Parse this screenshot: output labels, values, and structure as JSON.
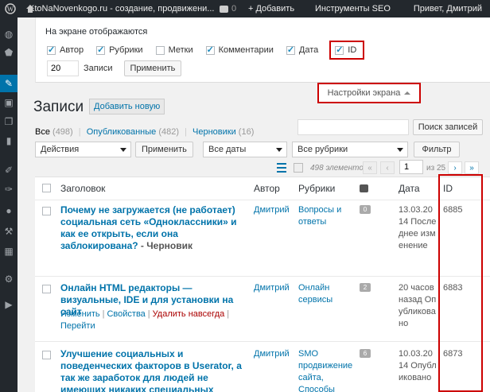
{
  "adminbar": {
    "site_name": "KtoNaNovenkogo.ru - создание, продвижени...",
    "comments_count": "0",
    "new_label": "Добавить",
    "seo_label": "Инструменты SEO",
    "greeting": "Привет, Дмитрий"
  },
  "screen_options": {
    "title": "На экране отображаются",
    "columns": [
      {
        "label": "Автор",
        "checked": true
      },
      {
        "label": "Рубрики",
        "checked": true
      },
      {
        "label": "Метки",
        "checked": false
      },
      {
        "label": "Комментарии",
        "checked": true
      },
      {
        "label": "Дата",
        "checked": true
      },
      {
        "label": "ID",
        "checked": true
      }
    ],
    "per_page_value": "20",
    "per_page_label": "Записи",
    "apply_label": "Применить",
    "toggle_label": "Настройки экрана"
  },
  "page": {
    "title": "Записи",
    "add_new": "Добавить новую"
  },
  "views": {
    "all_label": "Все",
    "all_count": "(498)",
    "published_label": "Опубликованные",
    "published_count": "(482)",
    "drafts_label": "Черновики",
    "drafts_count": "(16)"
  },
  "search": {
    "value": "",
    "button": "Поиск записей"
  },
  "tablenav": {
    "bulk_action": "Действия",
    "apply": "Применить",
    "dates": "Все даты",
    "categories": "Все рубрики",
    "filter": "Фильтр",
    "items": "498 элементов",
    "current_page": "1",
    "of_pages": "из 25",
    "first": "«",
    "prev": "‹",
    "next": "›",
    "last": "»"
  },
  "table": {
    "headers": {
      "title": "Заголовок",
      "author": "Автор",
      "categories": "Рубрики",
      "date": "Дата",
      "id": "ID"
    },
    "rows": [
      {
        "title": "Почему не загружается (не работает) социальная сеть «Одноклассники» и как ее открыть, если она заблокирована?",
        "status": " - Черновик",
        "author": "Дмитрий",
        "category": "Вопросы и ответы",
        "comments": "0",
        "date": "13.03.2014 Последнее изменение",
        "id": "6885"
      },
      {
        "title": "Онлайн HTML редакторы — визуальные, IDE и для установки на сайт",
        "status": "",
        "author": "Дмитрий",
        "category": "Онлайн сервисы",
        "comments": "2",
        "date": "20 часов назад Опубликовано",
        "id": "6883",
        "actions": {
          "edit": "Изменить",
          "quick": "Свойства",
          "trash": "Удалить навсегда",
          "view": "Перейти"
        }
      },
      {
        "title": "Улучшение социальных и поведенческих факторов в Userator, а так же заработок для людей не имеющих никаких специальных",
        "status": "",
        "author": "Дмитрий",
        "category": "SMO продвижение сайта, Способы",
        "comments": "6",
        "date": "10.03.2014 Опубликовано",
        "id": "6873"
      }
    ]
  },
  "menu_icons": [
    "dashboard-icon",
    "shield-icon",
    "posts-icon",
    "media-icon",
    "pages-icon",
    "comments-icon",
    "appearance-icon",
    "plugins-icon",
    "users-icon",
    "tools-icon",
    "settings-icon",
    "seo-icon",
    "gear-icon",
    "play-icon"
  ],
  "colors": {
    "accent": "#0073aa",
    "admin_bar": "#23282d",
    "highlight": "#cc0000"
  }
}
